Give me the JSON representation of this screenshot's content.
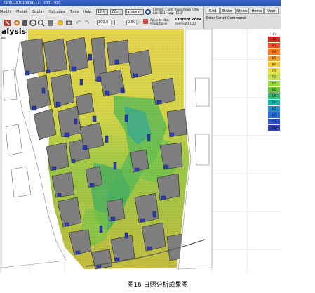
{
  "window": {
    "title": "Eshhiieldinanai17. cnn. ecn"
  },
  "menubar": {
    "items": [
      "Modify",
      "Model",
      "Display",
      "Calculate",
      "Tools",
      "Help"
    ]
  },
  "toolbar": {
    "time_value": "12:00",
    "day_value": "22nd",
    "month_value": "January",
    "step_value": "100.0",
    "step2_value": "0.50",
    "apply_label": "Apply to Objs:",
    "proportional_label": "Proportional",
    "current_zone_label": "Current Zone",
    "zone_sub_label": "overnight 1DD"
  },
  "climate": {
    "line1": "Climate: Clark_Youngstown_CWE",
    "line2": "Lat: 38.1° Lng: -13.3°",
    "line3": "Lat: 38.1°"
  },
  "right_panel": {
    "tabs": [
      "Grid",
      "Slider",
      "Styles",
      "Home",
      "User"
    ],
    "script_prompt": "Enter Script Command:"
  },
  "view": {
    "title": "alysis",
    "subtitle": "es"
  },
  "legend": {
    "unit": "Hrs",
    "levels": [
      {
        "label": "10",
        "color": "#d42a1a"
      },
      {
        "label": "9.5",
        "color": "#e8502a"
      },
      {
        "label": "9.0",
        "color": "#f07828"
      },
      {
        "label": "8.5",
        "color": "#f4a030"
      },
      {
        "label": "8.0",
        "color": "#f0c838"
      },
      {
        "label": "7.5",
        "color": "#e6e040"
      },
      {
        "label": "7.0",
        "color": "#c8e040"
      },
      {
        "label": "6.5",
        "color": "#9cd840"
      },
      {
        "label": "6.0",
        "color": "#60c848"
      },
      {
        "label": "5.5",
        "color": "#30b870"
      },
      {
        "label": "5.0",
        "color": "#20a8a8"
      },
      {
        "label": "4.5",
        "color": "#2090d0"
      },
      {
        "label": "4.0",
        "color": "#2870d8"
      },
      {
        "label": "3.5",
        "color": "#2a50c8"
      },
      {
        "label": "3.0",
        "color": "#2a3ab0"
      }
    ]
  },
  "caption": "图16 日照分析成果图"
}
